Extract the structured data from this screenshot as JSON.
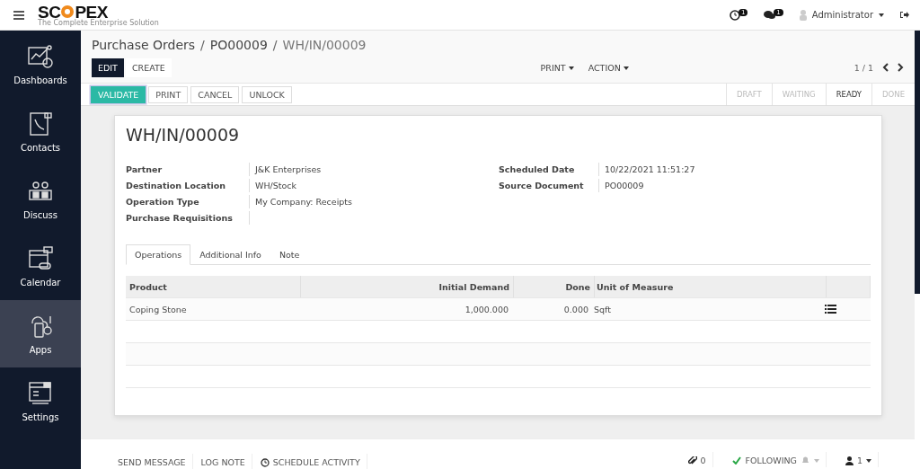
{
  "logo": {
    "left": "SC",
    "right": "PEX",
    "tagline": "The Complete Enterprise Solution"
  },
  "topbar": {
    "activity_count": "1",
    "message_count": "1",
    "user": "Administrator"
  },
  "sidebar": {
    "items": [
      {
        "label": "Dashboards",
        "selected": false
      },
      {
        "label": "Contacts",
        "selected": false
      },
      {
        "label": "Discuss",
        "selected": false
      },
      {
        "label": "Calendar",
        "selected": false
      },
      {
        "label": "Apps",
        "selected": true
      },
      {
        "label": "Settings",
        "selected": false
      }
    ]
  },
  "breadcrumbs": [
    "Purchase Orders",
    "PO00009",
    "WH/IN/00009"
  ],
  "breadcrumb_separators": [
    "/",
    "/"
  ],
  "actions": {
    "edit": "EDIT",
    "create": "CREATE",
    "print": "PRINT",
    "action": "ACTION",
    "pager": "1 / 1"
  },
  "buttons": [
    {
      "label": "VALIDATE",
      "primary": true
    },
    {
      "label": "PRINT",
      "primary": false
    },
    {
      "label": "CANCEL",
      "primary": false
    },
    {
      "label": "UNLOCK",
      "primary": false
    }
  ],
  "statusbar": [
    {
      "label": "DRAFT",
      "selected": false
    },
    {
      "label": "WAITING",
      "selected": false
    },
    {
      "label": "READY",
      "selected": true
    },
    {
      "label": "DONE",
      "selected": false
    }
  ],
  "form": {
    "title": "WH/IN/00009",
    "left_fields": [
      {
        "label": "Partner",
        "value": "J&K Enterprises"
      },
      {
        "label": "Destination Location",
        "value": "WH/Stock"
      },
      {
        "label": "Operation Type",
        "value": "My Company: Receipts"
      },
      {
        "label": "Purchase Requisitions"
      }
    ],
    "right_fields": [
      {
        "label": "Scheduled Date",
        "value": "10/22/2021 11:51:27"
      },
      {
        "label": "Source Document",
        "value": "PO00009"
      }
    ],
    "tabs": [
      {
        "label": "Operations",
        "selected": true
      },
      {
        "label": "Additional Info",
        "selected": false
      },
      {
        "label": "Note",
        "selected": false
      }
    ],
    "table": {
      "columns": [
        "Product",
        "Initial Demand",
        "Done",
        "Unit of Measure"
      ],
      "rows": [
        {
          "product": "Coping Stone",
          "initial_demand": "1,000.000",
          "done": "0.000",
          "uom": "Sqft"
        }
      ]
    }
  },
  "chatter": {
    "send_message": "SEND MESSAGE",
    "log_note": "LOG NOTE",
    "schedule_activity": "SCHEDULE ACTIVITY",
    "attachments": "0",
    "following": "FOLLOWING",
    "followers": "1"
  }
}
